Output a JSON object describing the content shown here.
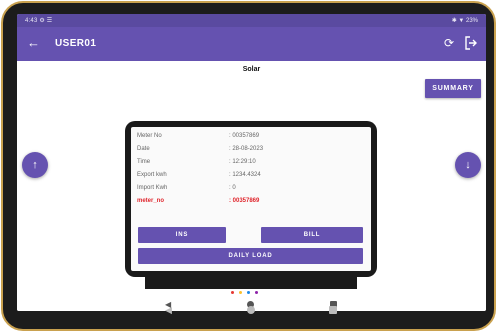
{
  "status_bar": {
    "time": "4:43",
    "left_icons": "⚙ ☰",
    "right_text": "✱ ▼ 23%"
  },
  "app_bar": {
    "title": "USER01",
    "back_icon": "arrow-left-icon",
    "refresh_icon": "refresh-icon",
    "logout_icon": "logout-icon"
  },
  "page": {
    "heading": "Solar",
    "summary_label": "SUMMARY"
  },
  "fabs": {
    "up_icon": "↑",
    "down_icon": "↓"
  },
  "meter_info": [
    {
      "label": "Meter No",
      "value": ": 00357869"
    },
    {
      "label": "Date",
      "value": ": 28-08-2023"
    },
    {
      "label": "Time",
      "value": ": 12:29:10"
    },
    {
      "label": "Export kwh",
      "value": ": 1234.4324"
    },
    {
      "label": "Import Kwh",
      "value": ": 0"
    },
    {
      "label": "meter_no",
      "value": ": 00357869"
    }
  ],
  "buttons": {
    "ins": "INS",
    "bill": "BILL",
    "daily_load": "DAILY LOAD"
  },
  "system_nav": {
    "back": "◀"
  },
  "colors": {
    "primary": "#6552b0",
    "status_bar": "#5a4aa0",
    "highlight": "#e0262d",
    "bezel_frame": "#c9a14f"
  }
}
